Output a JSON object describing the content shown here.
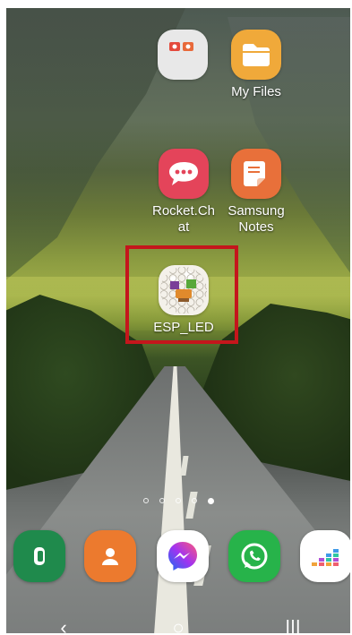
{
  "home": {
    "apps": [
      {
        "id": "folder",
        "label": ""
      },
      {
        "id": "my-files",
        "label": "My Files"
      },
      {
        "id": "rocket-chat",
        "label": "Rocket.Ch\nat"
      },
      {
        "id": "samsung-notes",
        "label": "Samsung\nNotes"
      },
      {
        "id": "esp-led",
        "label": "ESP_LED"
      }
    ],
    "page_indicator": {
      "pages": 5,
      "active_index": 4
    }
  },
  "dock": {
    "apps": [
      "phone",
      "contacts",
      "messenger",
      "whatsapp",
      "deezer"
    ]
  },
  "nav": {
    "back": "‹",
    "home": "○",
    "recents": "|||"
  },
  "colors": {
    "highlight": "#c4161c",
    "label_text": "#ffffff"
  }
}
